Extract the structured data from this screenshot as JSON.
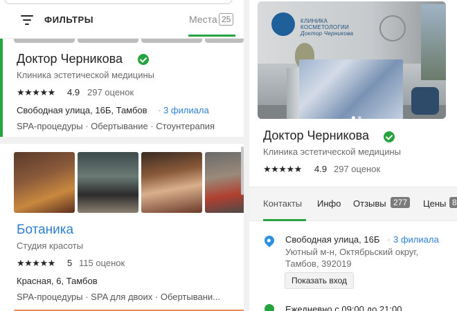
{
  "left_panel": {
    "filters_label": "ФИЛЬТРЫ",
    "places_label": "Места",
    "places_count": "25",
    "cards": [
      {
        "title": "Доктор Черникова",
        "subtitle": "Клиника эстетической медицины",
        "stars": "★★★★★",
        "rating": "4.9",
        "reviews": "297 оценок",
        "address": "Свободная улица, 16Б, Тамбов",
        "branches": "3 филиала",
        "tags": "SPA-процедуры · Обертывание · Стоунтерапия"
      },
      {
        "title": "Ботаника",
        "subtitle": "Студия красоты",
        "stars": "★★★★★",
        "rating": "5",
        "reviews": "115 оценок",
        "address": "Красная, 6, Тамбов",
        "tags": "SPA-процедуры · SPA для двоих · Обертывани..."
      }
    ]
  },
  "right_panel": {
    "hero": {
      "logo_text_line1": "КЛИНИКА",
      "logo_text_line2": "КОСМЕТОЛОГИИ",
      "logo_text_line3": "Доктор Черникова"
    },
    "title": "Доктор Черникова",
    "subtitle": "Клиника эстетической медицины",
    "stars": "★★★★★",
    "rating": "4.9",
    "reviews": "297 оценок",
    "tabs": [
      {
        "label": "Контакты"
      },
      {
        "label": "Инфо"
      },
      {
        "label": "Отзывы",
        "badge": "277"
      },
      {
        "label": "Цены",
        "badge": "8"
      }
    ],
    "address": "Свободная улица, 16Б",
    "branches": "3 филиала",
    "address_details": "Уютный м-н, Октябрьский округ, Тамбов, 392019",
    "show_entry_button": "Показать вход",
    "hours": "Ежедневно с 09:00 до 21:00"
  },
  "colors": {
    "accent_green": "#26a33f",
    "link_blue": "#2f7fd0",
    "pin_blue": "#2f8fe0"
  }
}
